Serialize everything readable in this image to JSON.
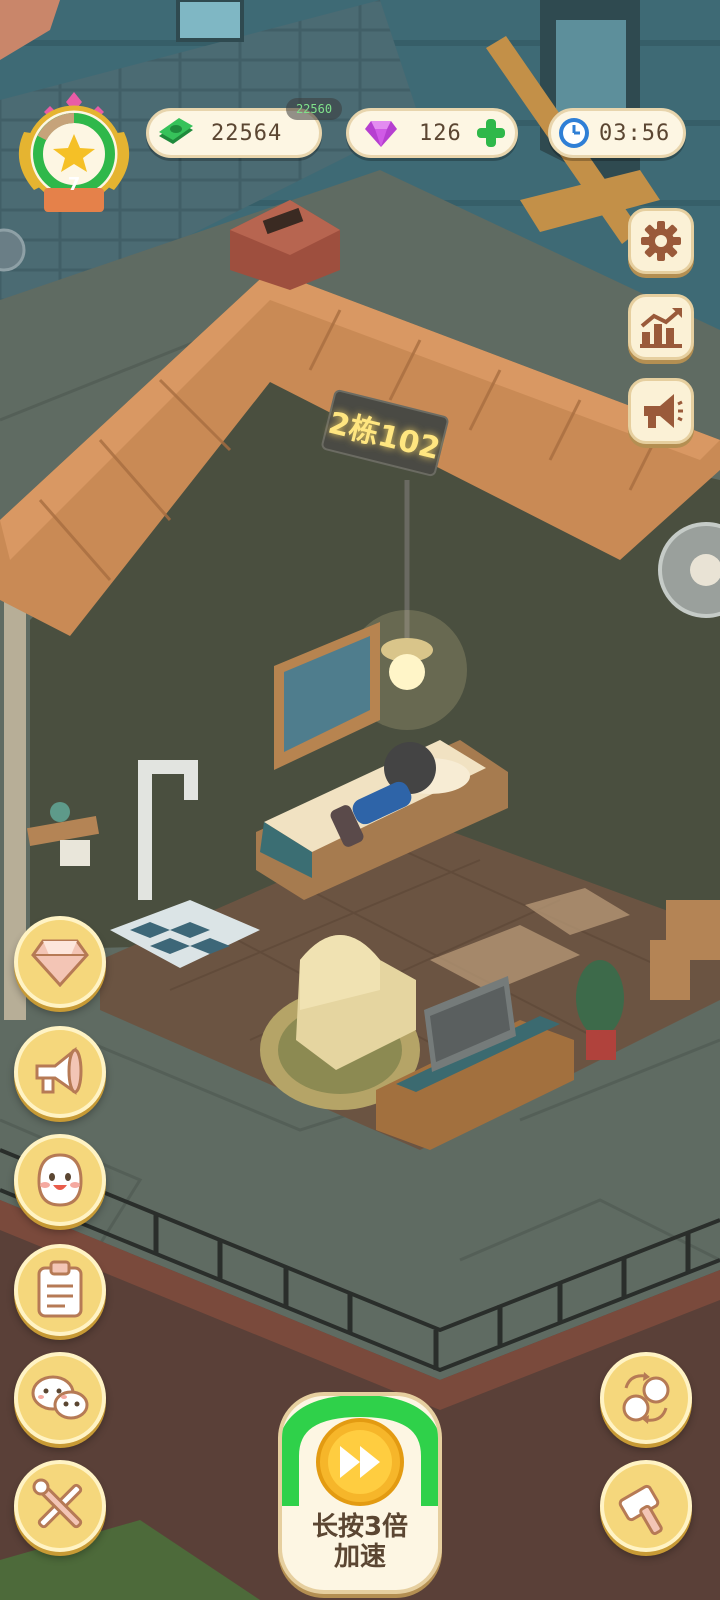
{
  "hud": {
    "level": "7",
    "cash": "22564",
    "cash_ghost": "22560",
    "gems": "126",
    "timer": "03:56"
  },
  "room_sign": "2栋102",
  "speed_button": {
    "line1": "长按3倍",
    "line2": "加速"
  },
  "icons": {
    "cash": "cash-icon",
    "gem": "gem-icon",
    "add": "plus-icon",
    "clock": "clock-icon",
    "settings": "gear-icon",
    "stats": "chart-icon",
    "announce": "megaphone-icon"
  },
  "colors": {
    "button_yellow": "#f5d77c",
    "pill_bg": "#fdf6e3",
    "accent_green": "#2fb84a",
    "gem_purple": "#b63fd0"
  }
}
